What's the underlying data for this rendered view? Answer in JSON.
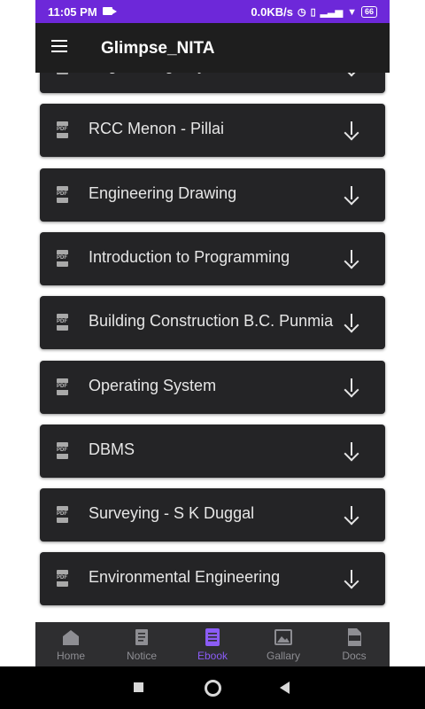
{
  "status": {
    "time": "11:05 PM",
    "net_speed": "0.0KB/s",
    "battery": "66"
  },
  "app": {
    "title": "Glimpse_NITA"
  },
  "books": [
    {
      "title": "Engineering Physics"
    },
    {
      "title": "RCC Menon - Pillai"
    },
    {
      "title": "Engineering Drawing"
    },
    {
      "title": "Introduction to Programming"
    },
    {
      "title": "Building Construction B.C. Punmia"
    },
    {
      "title": "Operating System"
    },
    {
      "title": "DBMS"
    },
    {
      "title": "Surveying - S K Duggal"
    },
    {
      "title": "Environmental Engineering"
    }
  ],
  "pdf_tag": "PDF",
  "nav": {
    "tabs": [
      {
        "label": "Home",
        "icon": "home-icon"
      },
      {
        "label": "Notice",
        "icon": "notice-icon"
      },
      {
        "label": "Ebook",
        "icon": "ebook-icon"
      },
      {
        "label": "Gallary",
        "icon": "gallery-icon"
      },
      {
        "label": "Docs",
        "icon": "docs-icon"
      }
    ],
    "active": "Ebook",
    "active_color": "#8b5cf6",
    "inactive_color": "#8e8e93"
  },
  "colors": {
    "status_bar": "#6d28d9",
    "app_bar": "#1e1e1e",
    "card": "#242426"
  }
}
